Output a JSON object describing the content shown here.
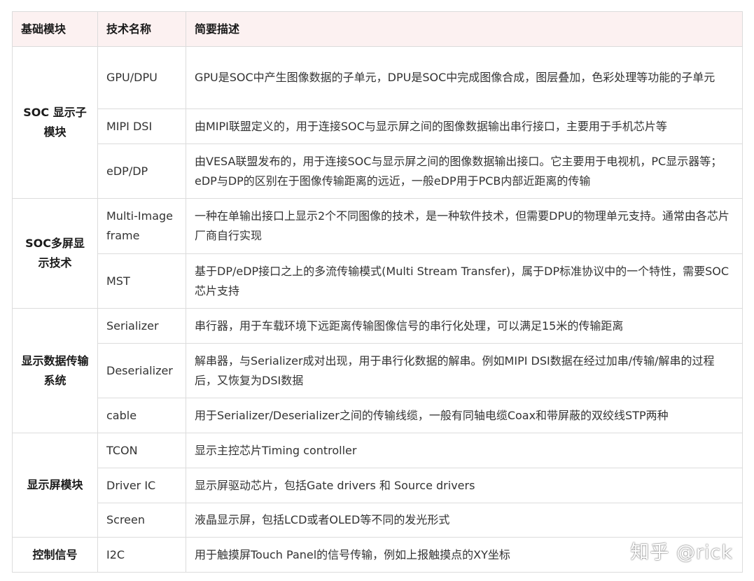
{
  "table": {
    "headers": [
      "基础模块",
      "技术名称",
      "简要描述"
    ],
    "groups": [
      {
        "name": "SOC 显示子模块",
        "rows": [
          {
            "tech": "GPU/DPU",
            "desc": "GPU是SOC中产生图像数据的子单元，DPU是SOC中完成图像合成，图层叠加，色彩处理等功能的子单元"
          },
          {
            "tech": "MIPI DSI",
            "desc": "由MIPI联盟定义的，用于连接SOC与显示屏之间的图像数据输出串行接口，主要用于手机芯片等"
          },
          {
            "tech": "eDP/DP",
            "desc": "由VESA联盟发布的，用于连接SOC与显示屏之间的图像数据输出接口。它主要用于电视机，PC显示器等；eDP与DP的区别在于图像传输距离的远近，一般eDP用于PCB内部近距离的传输"
          }
        ]
      },
      {
        "name": "SOC多屏显示技术",
        "rows": [
          {
            "tech": "Multi-Image frame",
            "desc": "一种在单输出接口上显示2个不同图像的技术，是一种软件技术，但需要DPU的物理单元支持。通常由各芯片厂商自行实现"
          },
          {
            "tech": "MST",
            "desc": "基于DP/eDP接口之上的多流传输模式(Multi Stream Transfer)，属于DP标准协议中的一个特性，需要SOC芯片支持"
          }
        ]
      },
      {
        "name": "显示数据传输系统",
        "rows": [
          {
            "tech": "Serializer",
            "desc": "串行器，用于车载环境下远距离传输图像信号的串行化处理，可以满足15米的传输距离"
          },
          {
            "tech": "Deserializer",
            "desc": "解串器，与Serializer成对出现，用于串行化数据的解串。例如MIPI DSI数据在经过加串/传输/解串的过程后，又恢复为DSI数据"
          },
          {
            "tech": "cable",
            "desc": "用于Serializer/Deserializer之间的传输线缆，一般有同轴电缆Coax和带屏蔽的双绞线STP两种"
          }
        ]
      },
      {
        "name": "显示屏模块",
        "rows": [
          {
            "tech": "TCON",
            "desc": "显示主控芯片Timing controller"
          },
          {
            "tech": "Driver IC",
            "desc": "显示屏驱动芯片，包括Gate drivers 和 Source drivers"
          },
          {
            "tech": "Screen",
            "desc": "液晶显示屏，包括LCD或者OLED等不同的发光形式"
          }
        ]
      },
      {
        "name": "控制信号",
        "rows": [
          {
            "tech": "I2C",
            "desc": "用于触摸屏Touch Panel的信号传输，例如上报触摸点的XY坐标"
          }
        ]
      }
    ]
  },
  "watermark": "知乎 @rick"
}
